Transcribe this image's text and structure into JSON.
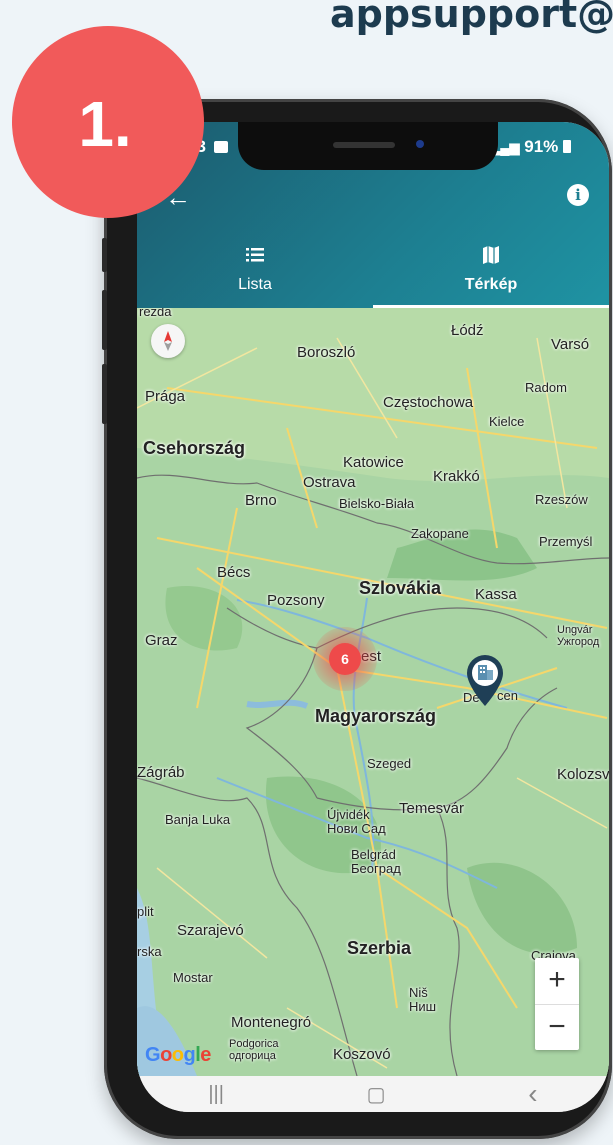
{
  "page": {
    "top_text": "appsupport@",
    "step_number": "1."
  },
  "status_bar": {
    "time": "03",
    "battery": "91%"
  },
  "header": {
    "tabs": [
      {
        "label": "Lista",
        "icon": "list-icon"
      },
      {
        "label": "Térkép",
        "icon": "map-icon",
        "active": true
      }
    ]
  },
  "map": {
    "labels": {
      "erzda": "rezda",
      "boroszlo": "Boroszló",
      "lodz": "Łódź",
      "varso": "Varsó",
      "praga": "Prága",
      "radom": "Radom",
      "czestochowa": "Częstochowa",
      "kielce": "Kielce",
      "csehorszag": "Csehország",
      "katowice": "Katowice",
      "ostrava": "Ostrava",
      "krakko": "Krakkó",
      "brno": "Brno",
      "bielsko": "Bielsko-Biała",
      "rzeszow": "Rzeszów",
      "zakopane": "Zakopane",
      "przemysl": "Przemyśl",
      "becs": "Bécs",
      "pozsony": "Pozsony",
      "szlovakia": "Szlovákia",
      "kassa": "Kassa",
      "ungvar": "Ungvár",
      "uzhorod": "Ужгород",
      "graz": "Graz",
      "budapest_end": "est",
      "debrecen_end": "cen",
      "debrecen_start": "De",
      "magyarorszag": "Magyarország",
      "zagrab": "Zágráb",
      "szeged": "Szeged",
      "kolozsv": "Kolozsv",
      "temesvar": "Temesvár",
      "banjaluka": "Banja Luka",
      "ujvidek": "Újvidék",
      "novisad": "Нови Сад",
      "belgrad": "Belgrád",
      "beograd": "Београд",
      "split": "plit",
      "szarajevo": "Szarajevó",
      "rska": "rska",
      "szerbia": "Szerbia",
      "craiova": "Craiova",
      "mostar": "Mostar",
      "nis": "Niš",
      "nis_cyr": "Ниш",
      "montenegro": "Montenegró",
      "podgorica": "Podgorica",
      "podgorica_cyr": "одгорица",
      "koszovo": "Koszovó"
    },
    "cluster_count": "6",
    "zoom_in": "+",
    "zoom_out": "−",
    "google": "Google"
  },
  "navbar": {
    "recent": "|||",
    "home": "▢",
    "back": "‹"
  }
}
